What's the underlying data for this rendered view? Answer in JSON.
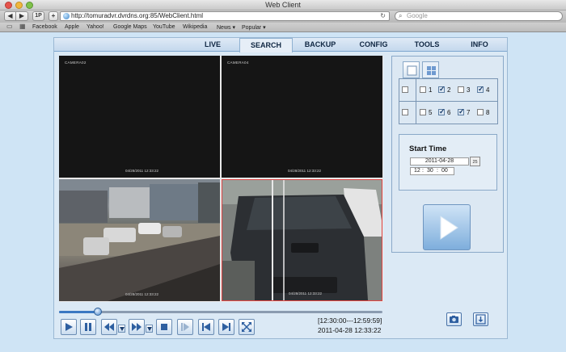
{
  "window": {
    "title": "Web Client"
  },
  "browser": {
    "back_icon": "back-arrow-icon",
    "forward_icon": "forward-arrow-icon",
    "onep_label": "1P",
    "add_label": "+",
    "url": "http://tomuradvr.dvrdns.org:85/WebClient.html",
    "search_placeholder": "Google",
    "bookmarks": [
      "Facebook",
      "Apple",
      "Yahoo!",
      "Google Maps",
      "YouTube",
      "Wikipedia",
      "News ▾",
      "Popular ▾"
    ]
  },
  "tabs": [
    {
      "label": "LIVE",
      "active": false
    },
    {
      "label": "SEARCH",
      "active": true
    },
    {
      "label": "BACKUP",
      "active": false
    },
    {
      "label": "CONFIG",
      "active": false
    },
    {
      "label": "TOOLS",
      "active": false
    },
    {
      "label": "INFO",
      "active": false
    }
  ],
  "cameras": [
    {
      "label": "CAMERA02",
      "timestamp": "04/28/2011  12:33:22"
    },
    {
      "label": "CAMERA04",
      "timestamp": "04/28/2011  12:33:22"
    },
    {
      "label": "",
      "timestamp": "04/28/2011  12:33:22"
    },
    {
      "label": "",
      "timestamp": "04/28/2011  12:33:22"
    }
  ],
  "playback": {
    "progress_fraction": 0.12,
    "time_range": "[12:30:00---12:59:59]",
    "current_time": "2011-04-28 12:33:22"
  },
  "channels": [
    {
      "num": "1",
      "checked": false
    },
    {
      "num": "2",
      "checked": true
    },
    {
      "num": "3",
      "checked": false
    },
    {
      "num": "4",
      "checked": true
    },
    {
      "num": "5",
      "checked": false
    },
    {
      "num": "6",
      "checked": true
    },
    {
      "num": "7",
      "checked": true
    },
    {
      "num": "8",
      "checked": false
    }
  ],
  "start_time": {
    "title": "Start Time",
    "date": "2011-04-28",
    "calendar_label": "25",
    "hour": "12",
    "minute": "30",
    "second": "00"
  },
  "colors": {
    "accent": "#3a78c2",
    "panel": "#dce8f3",
    "tab_text": "#0f2642"
  }
}
